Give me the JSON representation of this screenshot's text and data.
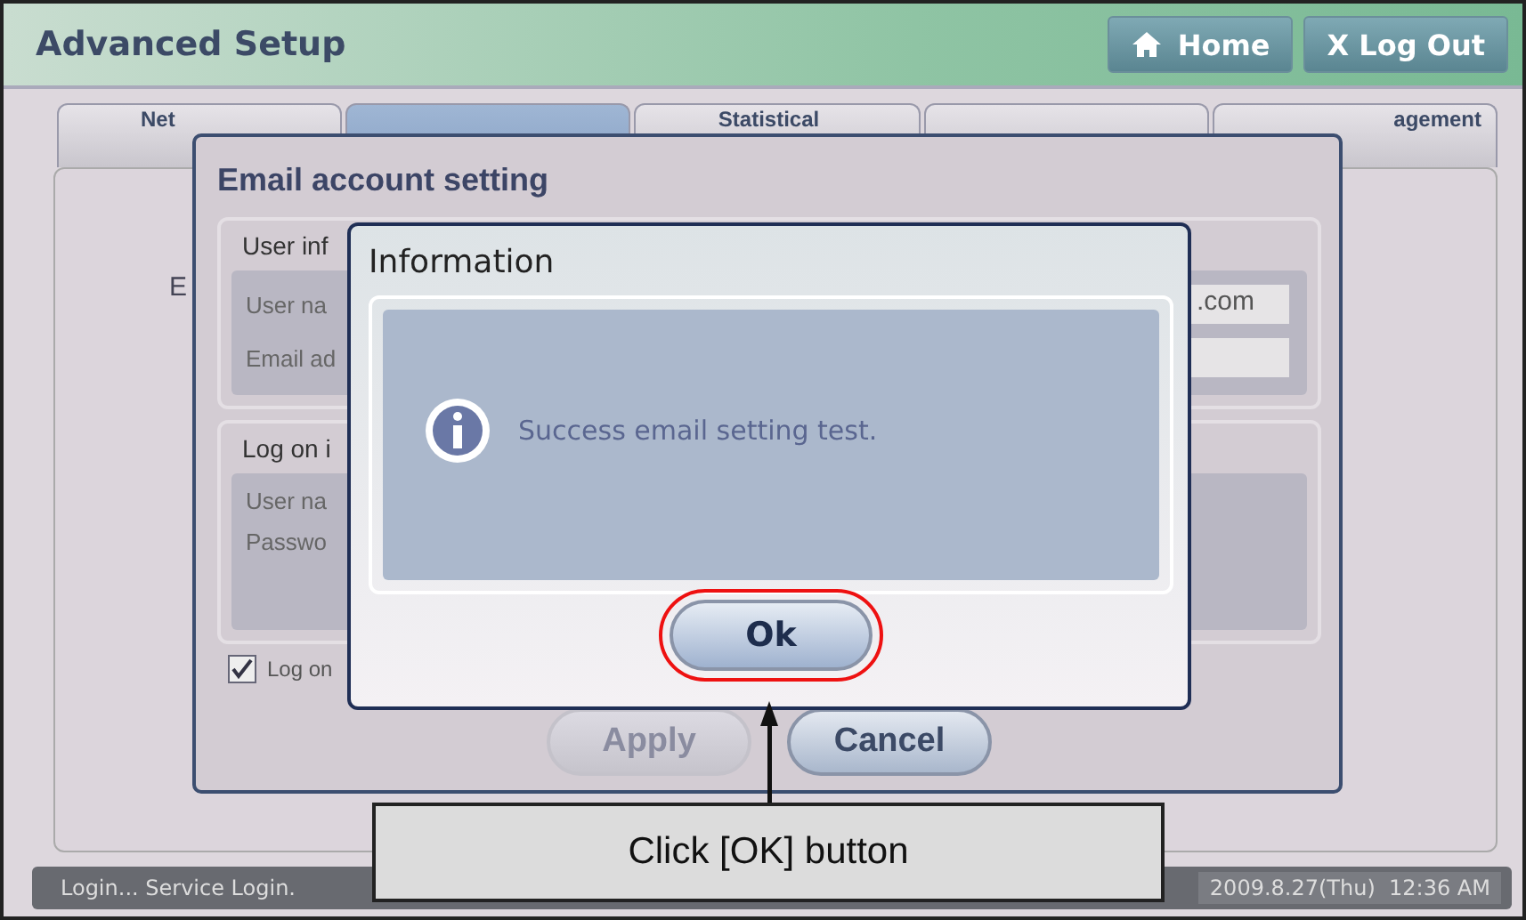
{
  "header": {
    "title": "Advanced Setup",
    "buttons": [
      {
        "label": "Home",
        "kind": "home"
      },
      {
        "label": "X Log Out",
        "kind": "logout"
      }
    ]
  },
  "tabs": [
    {
      "label": "Net",
      "selected": false
    },
    {
      "selected": true
    },
    {
      "label": "Statistical",
      "selected": false
    },
    {
      "selected": false
    },
    {
      "label": "agement",
      "selected": false
    }
  ],
  "panel": {
    "label": "E"
  },
  "email_dialog": {
    "title": "Email account setting",
    "sections": [
      {
        "title": "User inf",
        "fields": [
          {
            "label": "User na",
            "value": ".com"
          },
          {
            "label": "Email ad"
          }
        ]
      },
      {
        "title": "Log on i",
        "fields": [
          {
            "label": "User na"
          },
          {
            "label": "Passwo"
          }
        ]
      }
    ],
    "checkbox": {
      "label": "Log on",
      "checked": true
    },
    "buttons": [
      {
        "label": "Apply",
        "disabled": true
      },
      {
        "label": "Cancel",
        "disabled": false
      }
    ]
  },
  "info_dialog": {
    "title": "Information",
    "message": "Success email setting test.",
    "button": {
      "label": "Ok",
      "highlighted": true
    }
  },
  "callout": {
    "text": "Click [OK] button"
  },
  "status_bar": {
    "left": "Login... Service Login.",
    "right": "2009.8.27(Thu)  12:36 AM"
  }
}
